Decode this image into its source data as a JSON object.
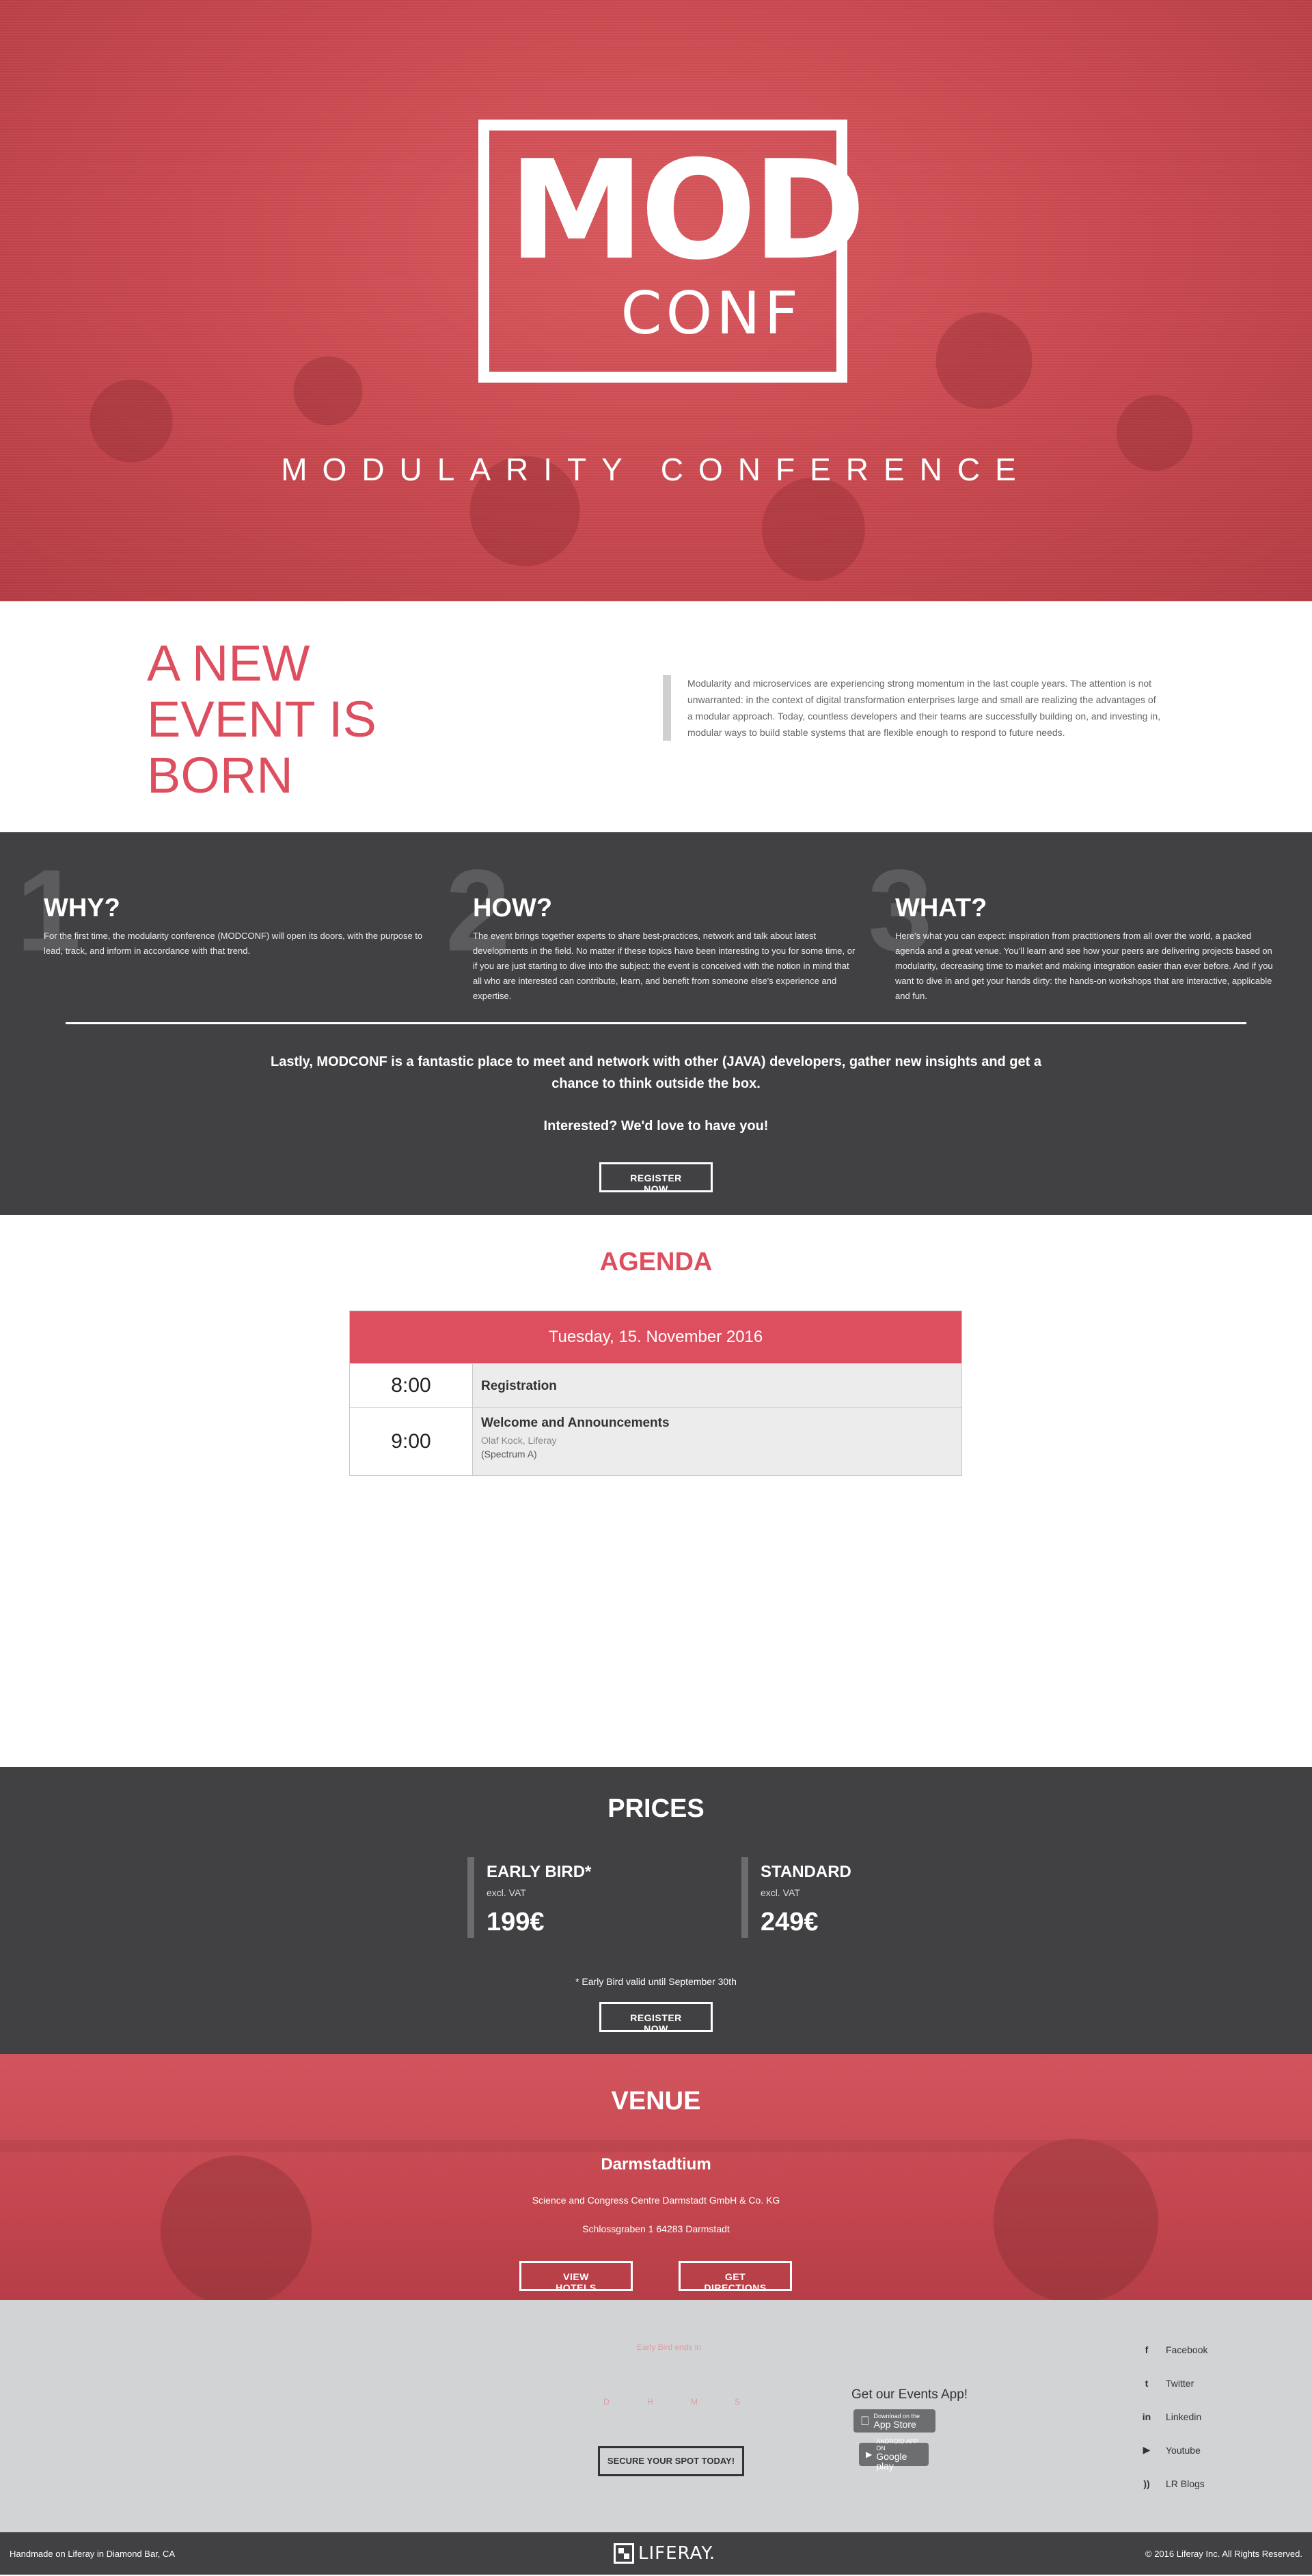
{
  "hero": {
    "logo_top": "MOD",
    "logo_bottom": "CONF",
    "tagline": "MODULARITY CONFERENCE"
  },
  "intro": {
    "headline": "A NEW EVENT IS BORN",
    "text": "Modularity and microservices are experiencing strong momentum in the last couple years. The attention is not unwarranted: in the context of digital transformation enterprises large and small are realizing the advantages of a modular approach. Today, countless developers and their teams are successfully building on, and investing in, modular ways to build stable systems that are flexible enough to respond to future needs."
  },
  "pillars": [
    {
      "num": "1",
      "title": "WHY?",
      "text": "For the first time, the modularity conference (MODCONF) will open its doors, with the purpose to lead, track, and inform in accordance with that trend."
    },
    {
      "num": "2",
      "title": "HOW?",
      "text": "The event brings together experts to share best-practices, network and talk about latest developments in the field. No matter if these topics have been interesting to you for some time, or if you are just starting to dive into the subject: the event is conceived with the notion in mind that all who are interested can contribute, learn, and benefit from someone else's experience and expertise."
    },
    {
      "num": "3",
      "title": "WHAT?",
      "text": "Here's what you can expect: inspiration from practitioners from all over the world, a packed agenda and a great venue. You'll learn and see how your peers are delivering projects based on modularity, decreasing time to market and making integration easier than ever before. And if you want to dive in and get your hands dirty: the hands-on workshops that are interactive, applicable and fun."
    }
  ],
  "closing": {
    "text": "Lastly, MODCONF is a fantastic place to meet and network with other (JAVA) developers, gather new insights and get a chance to think outside the box.",
    "interest": "Interested? We'd love to have you!",
    "register_label": "REGISTER NOW"
  },
  "agenda": {
    "title": "AGENDA",
    "day": "Tuesday, 15. November 2016",
    "rows": [
      {
        "time": "8:00",
        "title": "Registration"
      },
      {
        "time": "9:00",
        "title": "Welcome and Announcements",
        "speaker": "Olaf Kock, Liferay",
        "room": "(Spectrum A)"
      }
    ]
  },
  "prices": {
    "title": "PRICES",
    "cards": [
      {
        "name": "EARLY BIRD*",
        "vat": "excl. VAT",
        "amount": "199€"
      },
      {
        "name": "STANDARD",
        "vat": "excl. VAT",
        "amount": "249€"
      }
    ],
    "note": "* Early Bird valid until September 30th",
    "register_label": "REGISTER NOW"
  },
  "venue": {
    "title": "VENUE",
    "name": "Darmstadtium",
    "address1": "Science and Congress Centre Darmstadt GmbH & Co. KG",
    "address2": "Schlossgraben 1 64283 Darmstadt",
    "hotels_label": "VIEW HOTELS",
    "directions_label": "GET DIRECTIONS"
  },
  "footer": {
    "early_text": "Early Bird ends in",
    "countdown": [
      "D",
      "H",
      "M",
      "S"
    ],
    "secure_label": "SECURE YOUR SPOT TODAY!",
    "app_title": "Get our Events App!",
    "appstore_small": "Download on the",
    "appstore_big": "App Store",
    "googleplay_small": "ANDROID APP ON",
    "googleplay_big": "Google play",
    "social": [
      {
        "icon": "facebook-icon",
        "glyph": "f",
        "label": "Facebook"
      },
      {
        "icon": "twitter-icon",
        "glyph": "t",
        "label": "Twitter"
      },
      {
        "icon": "linkedin-icon",
        "glyph": "in",
        "label": "Linkedin"
      },
      {
        "icon": "youtube-icon",
        "glyph": "▶",
        "label": "Youtube"
      },
      {
        "icon": "rss-icon",
        "glyph": "))",
        "label": "LR Blogs"
      }
    ],
    "left_text": "Handmade on Liferay in Diamond Bar, CA",
    "brand": "LIFERAY.",
    "right_text": "© 2016 Liferay Inc. All Rights Reserved."
  },
  "colors": {
    "accent": "#dd4f5e",
    "dark": "#414143",
    "footer_bg": "#d2d3d5"
  }
}
